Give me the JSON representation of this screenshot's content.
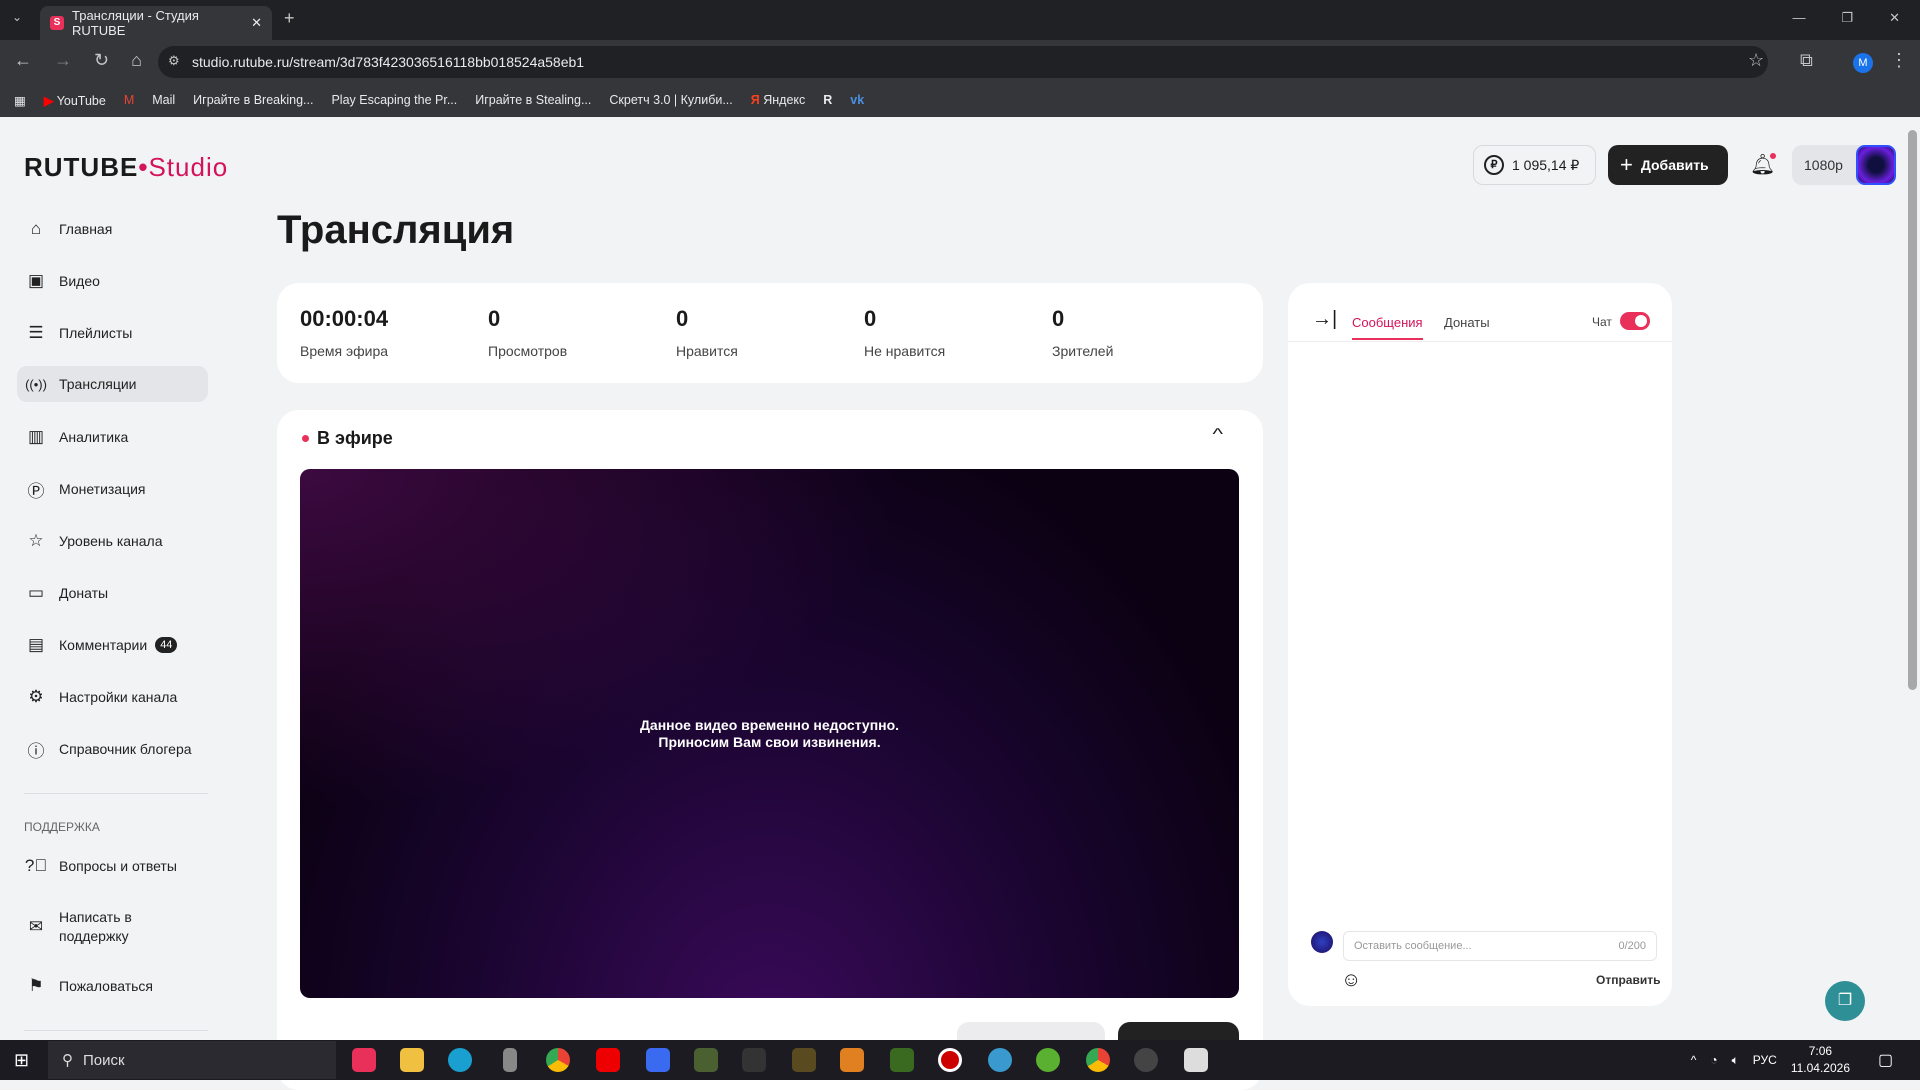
{
  "browser": {
    "tab_title": "Трансляции - Студия RUTUBE",
    "url": "studio.rutube.ru/stream/3d783f423036516118bb018524a58eb1",
    "bookmarks": [
      "YouTube",
      "Mail",
      "Играйте в Breaking...",
      "Play Escaping the Pr...",
      "Играйте в Stealing...",
      "Скретч 3.0 | Кулиби...",
      "Яндекс"
    ]
  },
  "logo": {
    "brand": "RUTUBE",
    "product": "Studio"
  },
  "header": {
    "balance": "1 095,14 ₽",
    "add_label": "Добавить",
    "quality": "1080p"
  },
  "sidebar": {
    "items": [
      {
        "label": "Главная",
        "icon": "home-icon"
      },
      {
        "label": "Видео",
        "icon": "video-icon"
      },
      {
        "label": "Плейлисты",
        "icon": "playlist-icon"
      },
      {
        "label": "Трансляции",
        "icon": "broadcast-icon"
      },
      {
        "label": "Аналитика",
        "icon": "analytics-icon"
      },
      {
        "label": "Монетизация",
        "icon": "ruble-icon"
      },
      {
        "label": "Уровень канала",
        "icon": "star-icon"
      },
      {
        "label": "Донаты",
        "icon": "wallet-icon"
      },
      {
        "label": "Комментарии",
        "icon": "comment-icon",
        "badge": "44"
      },
      {
        "label": "Настройки канала",
        "icon": "gear-icon"
      },
      {
        "label": "Справочник блогера",
        "icon": "info-icon"
      }
    ],
    "support_label": "ПОДДЕРЖКА",
    "support": [
      {
        "label": "Вопросы и ответы"
      },
      {
        "label": "Написать в поддержку"
      },
      {
        "label": "Пожаловаться"
      }
    ]
  },
  "page": {
    "title": "Трансляция",
    "stats": [
      {
        "value": "00:00:04",
        "label": "Время эфира"
      },
      {
        "value": "0",
        "label": "Просмотров"
      },
      {
        "value": "0",
        "label": "Нравится"
      },
      {
        "value": "0",
        "label": "Не нравится"
      },
      {
        "value": "0",
        "label": "Зрителей"
      }
    ],
    "live_label": "В эфире",
    "video_msg1": "Данное видео временно недоступно.",
    "video_msg2": "Приносим Вам свои извинения."
  },
  "chat": {
    "tab_messages": "Сообщения",
    "tab_donates": "Донаты",
    "chat_label": "Чат",
    "chat_enabled": true,
    "placeholder": "Оставить сообщение...",
    "counter": "0/200",
    "send": "Отправить"
  },
  "taskbar": {
    "search": "Поиск",
    "lang": "РУС",
    "time": "7:06",
    "date": "11.04.2026"
  },
  "colors": {
    "accent": "#e8305b",
    "dark": "#222222"
  }
}
